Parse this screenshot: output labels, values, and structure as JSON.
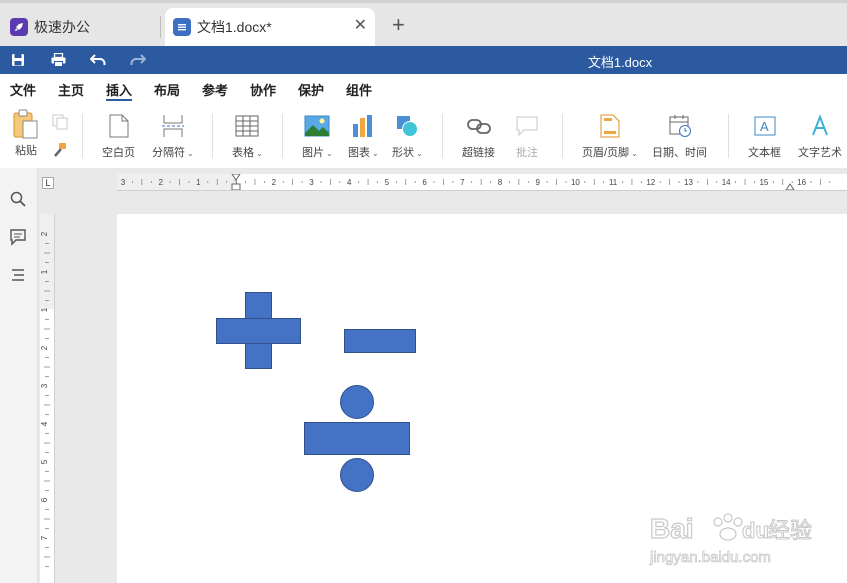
{
  "tabs": {
    "app_tab": {
      "title": "极速办公"
    },
    "doc_tab": {
      "title": "文档1.docx*"
    }
  },
  "titlebar": {
    "document_title": "文档1.docx"
  },
  "menu": {
    "items": [
      "文件",
      "主页",
      "插入",
      "布局",
      "参考",
      "协作",
      "保护",
      "组件"
    ],
    "active": "插入"
  },
  "toolbar": {
    "paste": "粘贴",
    "blank_page": "空白页",
    "separator": "分隔符",
    "table": "表格",
    "image": "图片",
    "chart": "图表",
    "shape": "形状",
    "hyperlink": "超链接",
    "comment": "批注",
    "header_footer": "页眉/页脚",
    "date_time": "日期、时间",
    "text_box": "文本框",
    "word_art": "文字艺术"
  },
  "ruler": {
    "horizontal_labels": [
      "3",
      "2",
      "1",
      "1",
      "2",
      "3",
      "4",
      "5",
      "6",
      "7",
      "8",
      "9",
      "10",
      "11",
      "12",
      "13",
      "14",
      "15",
      "16"
    ],
    "vertical_labels": [
      "2",
      "1",
      "1",
      "2",
      "3",
      "4",
      "5",
      "6",
      "7"
    ]
  },
  "colors": {
    "brand": "#2c5aa0",
    "shape_fill": "#4472c4",
    "shape_stroke": "#2f528f",
    "app_icon": "#5c3bb0"
  },
  "watermark": {
    "brand": "Bai",
    "brand2": "du",
    "suffix": "经验",
    "url": "jingyan.baidu.com"
  }
}
